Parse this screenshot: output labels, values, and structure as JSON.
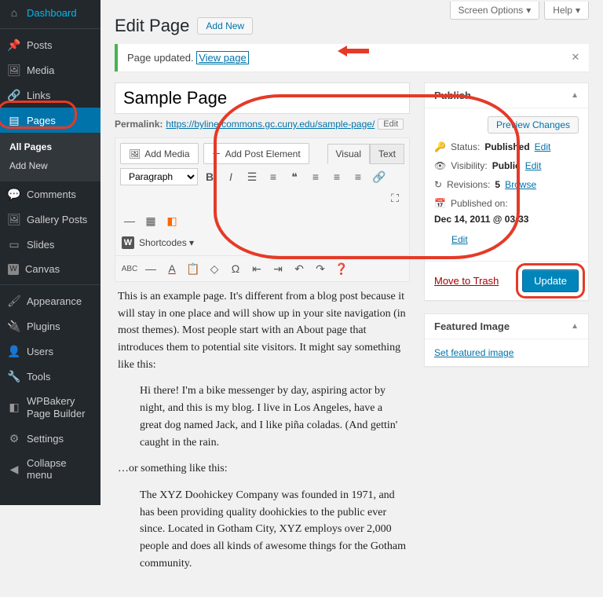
{
  "topTabs": {
    "screenOptions": "Screen Options",
    "help": "Help"
  },
  "sidebar": {
    "items": [
      {
        "icon": "gauge",
        "label": "Dashboard"
      },
      {
        "icon": "pin",
        "label": "Posts"
      },
      {
        "icon": "media",
        "label": "Media"
      },
      {
        "icon": "link",
        "label": "Links"
      },
      {
        "icon": "page",
        "label": "Pages",
        "current": true,
        "sub": [
          {
            "label": "All Pages",
            "current": true
          },
          {
            "label": "Add New"
          }
        ]
      },
      {
        "icon": "comment",
        "label": "Comments"
      },
      {
        "icon": "gallery",
        "label": "Gallery Posts"
      },
      {
        "icon": "slides",
        "label": "Slides"
      },
      {
        "icon": "canvas",
        "label": "Canvas"
      },
      {
        "sep": true
      },
      {
        "icon": "brush",
        "label": "Appearance"
      },
      {
        "icon": "plug",
        "label": "Plugins"
      },
      {
        "icon": "users",
        "label": "Users"
      },
      {
        "icon": "wrench",
        "label": "Tools"
      },
      {
        "icon": "wpb",
        "label": "WPBakery Page Builder"
      },
      {
        "icon": "sliders",
        "label": "Settings"
      },
      {
        "icon": "collapse",
        "label": "Collapse menu"
      }
    ]
  },
  "heading": {
    "title": "Edit Page",
    "addNew": "Add New"
  },
  "notice": {
    "text": "Page updated.",
    "viewLink": "View page"
  },
  "editor": {
    "titleValue": "Sample Page",
    "permalinkLabel": "Permalink:",
    "permalinkUrl": "https://byline.commons.gc.cuny.edu/sample-page/",
    "permalinkEdit": "Edit",
    "addMedia": "Add Media",
    "addPostElement": "Add Post Element",
    "tabVisual": "Visual",
    "tabText": "Text",
    "formatSel": "Paragraph",
    "shortcodes": "Shortcodes"
  },
  "content": {
    "p1": "This is an example page. It's different from a blog post because it will stay in one place and will show up in your site navigation (in most themes). Most people start with an About page that introduces them to potential site visitors. It might say something like this:",
    "q1": "Hi there! I'm a bike messenger by day, aspiring actor by night, and this is my blog. I live in Los Angeles, have a great dog named Jack, and I like piña coladas. (And gettin' caught in the rain.",
    "p2": "…or something like this:",
    "q2": "The XYZ Doohickey Company was founded in 1971, and has been providing quality doohickies to the public ever since. Located in Gotham City, XYZ employs over 2,000 people and does all kinds of awesome things for the Gotham community."
  },
  "publish": {
    "heading": "Publish",
    "previewBtn": "Preview Changes",
    "statusLabel": "Status:",
    "statusVal": "Published",
    "visibilityLabel": "Visibility:",
    "visibilityVal": "Public",
    "revisionsLabel": "Revisions:",
    "revisionsVal": "5",
    "browse": "Browse",
    "publishedOnLabel": "Published on:",
    "publishedOnVal": "Dec 14, 2011 @ 03:33",
    "editLink": "Edit",
    "trash": "Move to Trash",
    "updateBtn": "Update"
  },
  "featured": {
    "heading": "Featured Image",
    "link": "Set featured image"
  }
}
